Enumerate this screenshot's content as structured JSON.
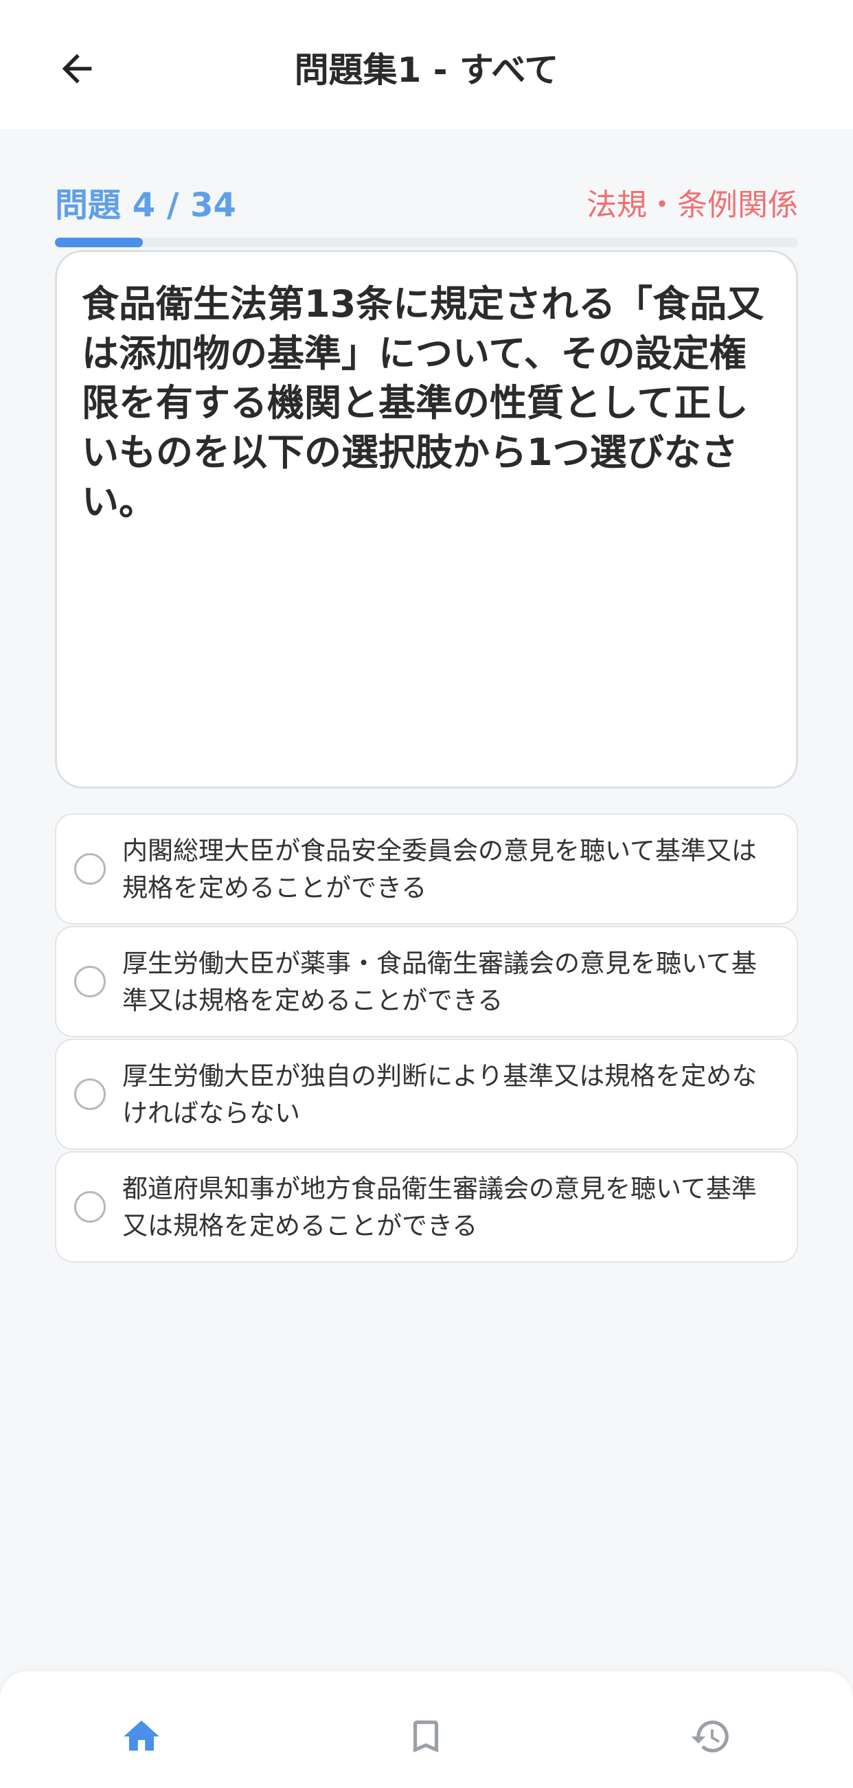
{
  "header": {
    "title": "問題集1 - すべて",
    "back_icon": "arrow-left-icon"
  },
  "progress": {
    "label": "問題 4 / 34",
    "current": 4,
    "total": 34,
    "fill_fraction": 0.118,
    "category": "法規・条例関係"
  },
  "question": {
    "text": "食品衛生法第13条に規定される「食品又は添加物の基準」について、その設定権限を有する機関と基準の性質として正しいものを以下の選択肢から1つ選びなさい。"
  },
  "options": [
    {
      "text": "内閣総理大臣が食品安全委員会の意見を聴いて基準又は規格を定めることができる",
      "selected": false
    },
    {
      "text": "厚生労働大臣が薬事・食品衛生審議会の意見を聴いて基準又は規格を定めることができる",
      "selected": false
    },
    {
      "text": "厚生労働大臣が独自の判断により基準又は規格を定めなければならない",
      "selected": false
    },
    {
      "text": "都道府県知事が地方食品衛生審議会の意見を聴いて基準又は規格を定めることができる",
      "selected": false
    }
  ],
  "nav": {
    "items": [
      {
        "icon": "home-icon",
        "active": true
      },
      {
        "icon": "bookmark-icon",
        "active": false
      },
      {
        "icon": "history-icon",
        "active": false
      }
    ]
  },
  "colors": {
    "accent": "#4a90e8",
    "progress_text": "#5fa0e6",
    "category_text": "#f07070",
    "nav_inactive": "#9aa0a6",
    "background": "#f6f7f9"
  }
}
